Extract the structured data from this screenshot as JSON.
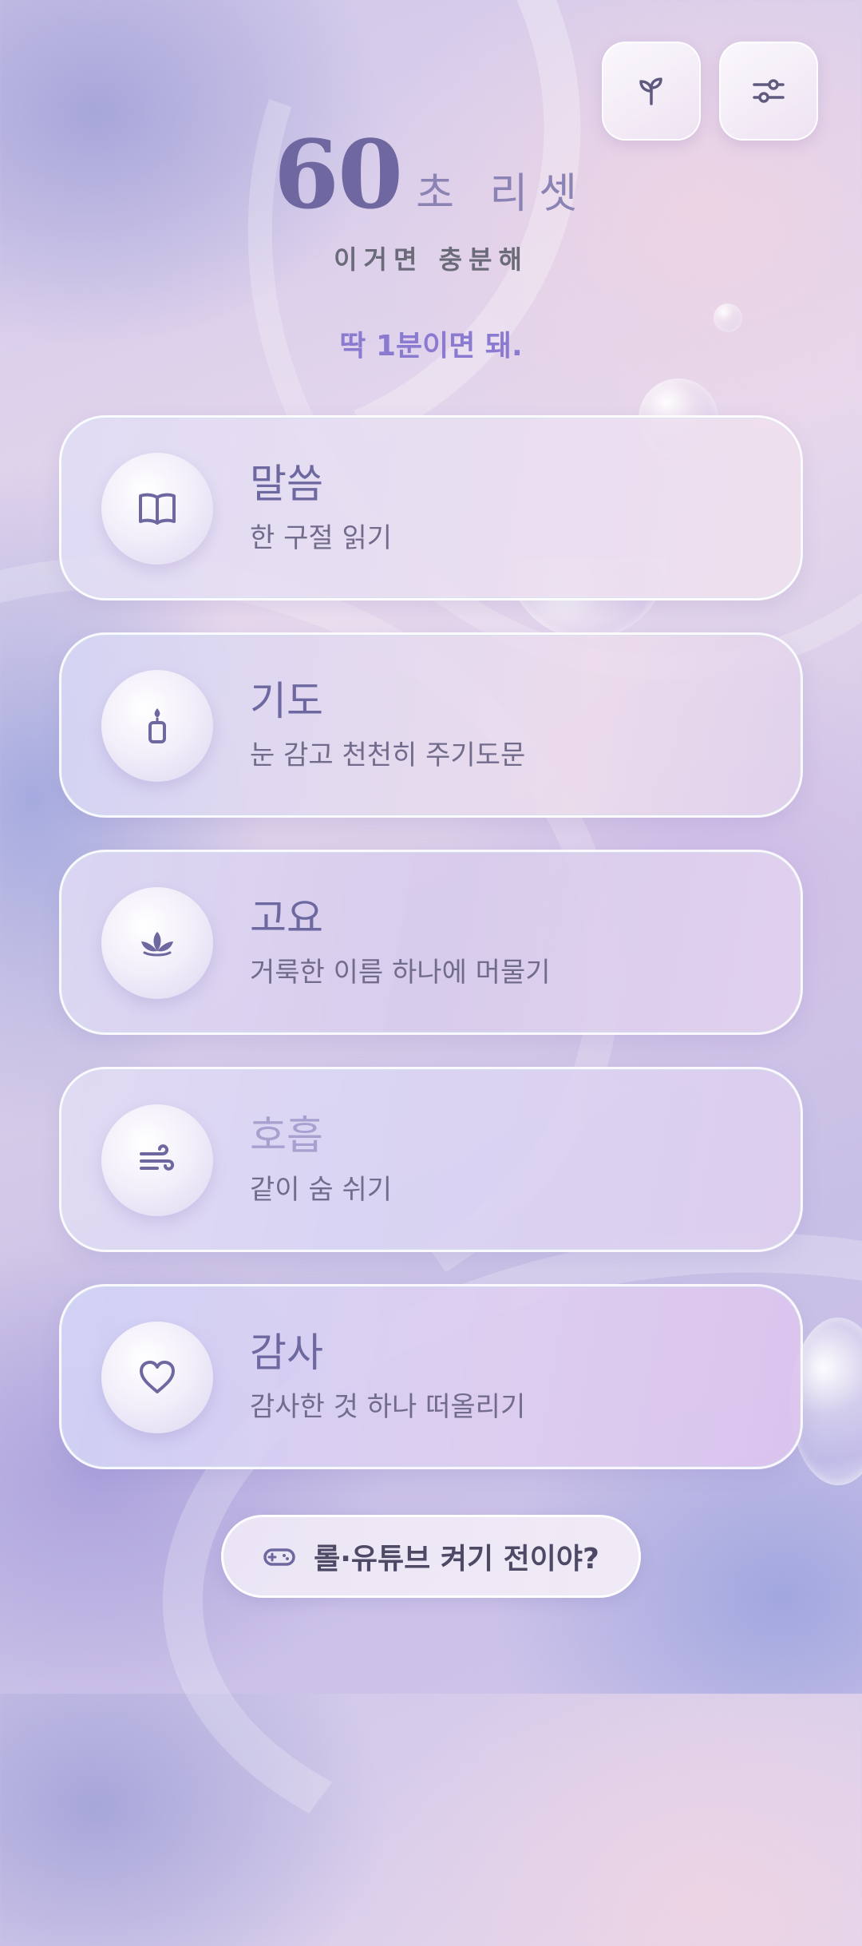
{
  "header": {
    "title_number": "60",
    "title_word": "초 리셋",
    "subtitle": "이거면 충분해",
    "tagline": "딱 1분이면 돼."
  },
  "top_buttons": {
    "growth_icon": "sprout-icon",
    "settings_icon": "sliders-icon"
  },
  "cards": [
    {
      "title": "말씀",
      "subtitle": "한 구절 읽기",
      "icon": "book-icon"
    },
    {
      "title": "기도",
      "subtitle": "눈 감고 천천히 주기도문",
      "icon": "candle-icon"
    },
    {
      "title": "고요",
      "subtitle": "거룩한 이름 하나에 머물기",
      "icon": "lotus-icon"
    },
    {
      "title": "호흡",
      "subtitle": "같이 숨 쉬기",
      "icon": "wind-icon"
    },
    {
      "title": "감사",
      "subtitle": "감사한 것 하나 떠올리기",
      "icon": "heart-icon"
    }
  ],
  "bottom_button": {
    "label": "롤·유튜브 켜기 전이야?",
    "icon": "gamepad-icon"
  },
  "colors": {
    "accent": "#6e68a0",
    "tagline": "#8a7bd1"
  }
}
